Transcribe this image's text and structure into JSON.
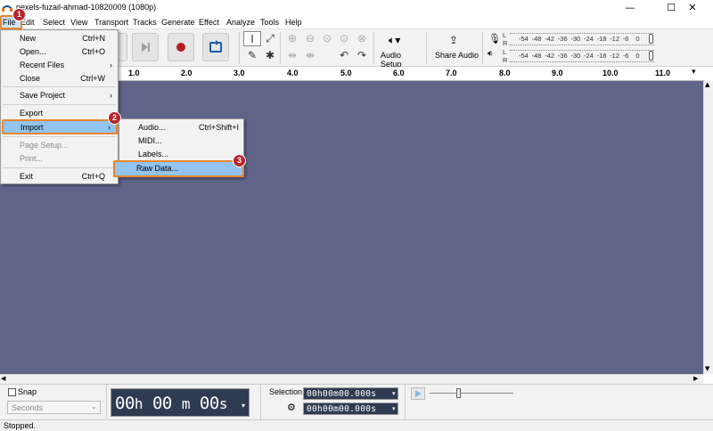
{
  "window": {
    "title": "pexels-fuzail-ahmad-10820009 (1080p)",
    "minimize": "—",
    "maximize": "☐",
    "close": "✕"
  },
  "menubar": [
    "File",
    "Edit",
    "Select",
    "View",
    "Transport",
    "Tracks",
    "Generate",
    "Effect",
    "Analyze",
    "Tools",
    "Help"
  ],
  "toolbar": {
    "audio_setup": "Audio Setup",
    "share_audio": "Share Audio"
  },
  "meters": {
    "recording": [
      "-54",
      "-48",
      "-42",
      "-36",
      "-30",
      "-24",
      "-18",
      "-12",
      "-6",
      "0"
    ],
    "playback": [
      "-54",
      "-48",
      "-42",
      "-36",
      "-30",
      "-24",
      "-18",
      "-12",
      "-6",
      "0"
    ],
    "left": "L",
    "right": "R"
  },
  "ruler": [
    "1.0",
    "2.0",
    "3.0",
    "4.0",
    "5.0",
    "6.0",
    "7.0",
    "8.0",
    "9.0",
    "10.0",
    "11.0"
  ],
  "file_menu": {
    "new": {
      "label": "New",
      "shortcut": "Ctrl+N"
    },
    "open": {
      "label": "Open...",
      "shortcut": "Ctrl+O"
    },
    "recent": {
      "label": "Recent Files"
    },
    "close": {
      "label": "Close",
      "shortcut": "Ctrl+W"
    },
    "save": {
      "label": "Save Project"
    },
    "export": {
      "label": "Export"
    },
    "import": {
      "label": "Import"
    },
    "page_setup": {
      "label": "Page Setup..."
    },
    "print": {
      "label": "Print..."
    },
    "exit": {
      "label": "Exit",
      "shortcut": "Ctrl+Q"
    }
  },
  "import_submenu": {
    "audio": {
      "label": "Audio...",
      "shortcut": "Ctrl+Shift+I"
    },
    "midi": {
      "label": "MIDI..."
    },
    "labels": {
      "label": "Labels..."
    },
    "raw": {
      "label": "Raw Data..."
    }
  },
  "badges": [
    "1",
    "2",
    "3"
  ],
  "bottom": {
    "snap": "Snap",
    "snap_unit": "Seconds",
    "time": {
      "h": "00",
      "hl": "h",
      "m": "00",
      "ml": "m",
      "s": "00",
      "sl": "s"
    },
    "selection_label": "Selection",
    "selection_start": "00h00m00.000s",
    "selection_end": "00h00m00.000s"
  },
  "status": "Stopped.",
  "colors": {
    "track_bg": "#5f6488",
    "highlight": "#92c4ef",
    "callout": "#e8852b",
    "badge": "#b8242a"
  }
}
